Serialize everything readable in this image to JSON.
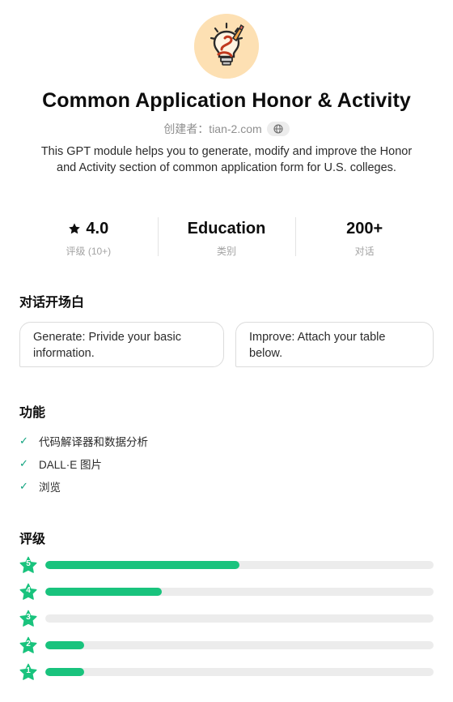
{
  "gpt": {
    "avatar_icon": "lightbulb-pencil-logo",
    "title": "Common Application Honor & Activity",
    "creator": "创建者：tian-2.com",
    "creator_icon": "globe-icon",
    "description": "This GPT module helps you to generate, modify and improve the Honor and Activity section of common application form for U.S. colleges."
  },
  "stats": [
    {
      "value": "4.0",
      "label": "评级 (10+)",
      "icon": "star-icon"
    },
    {
      "value": "Education",
      "label": "类别"
    },
    {
      "value": "200+",
      "label": "对话"
    }
  ],
  "starters": {
    "heading": "对话开场白",
    "items": [
      {
        "text": "Generate: Privide your basic information."
      },
      {
        "text": "Improve: Attach your table below."
      }
    ]
  },
  "capabilities": {
    "heading": "功能",
    "items": [
      {
        "label": "代码解译器和数据分析"
      },
      {
        "label": "DALL·E 图片"
      },
      {
        "label": "浏览"
      }
    ]
  },
  "ratings": {
    "heading": "评级",
    "accent_color": "#19c37d",
    "rows": [
      {
        "stars": "5",
        "fraction": 0.5
      },
      {
        "stars": "4",
        "fraction": 0.3
      },
      {
        "stars": "3",
        "fraction": 0.0
      },
      {
        "stars": "2",
        "fraction": 0.1
      },
      {
        "stars": "1",
        "fraction": 0.1
      }
    ]
  }
}
